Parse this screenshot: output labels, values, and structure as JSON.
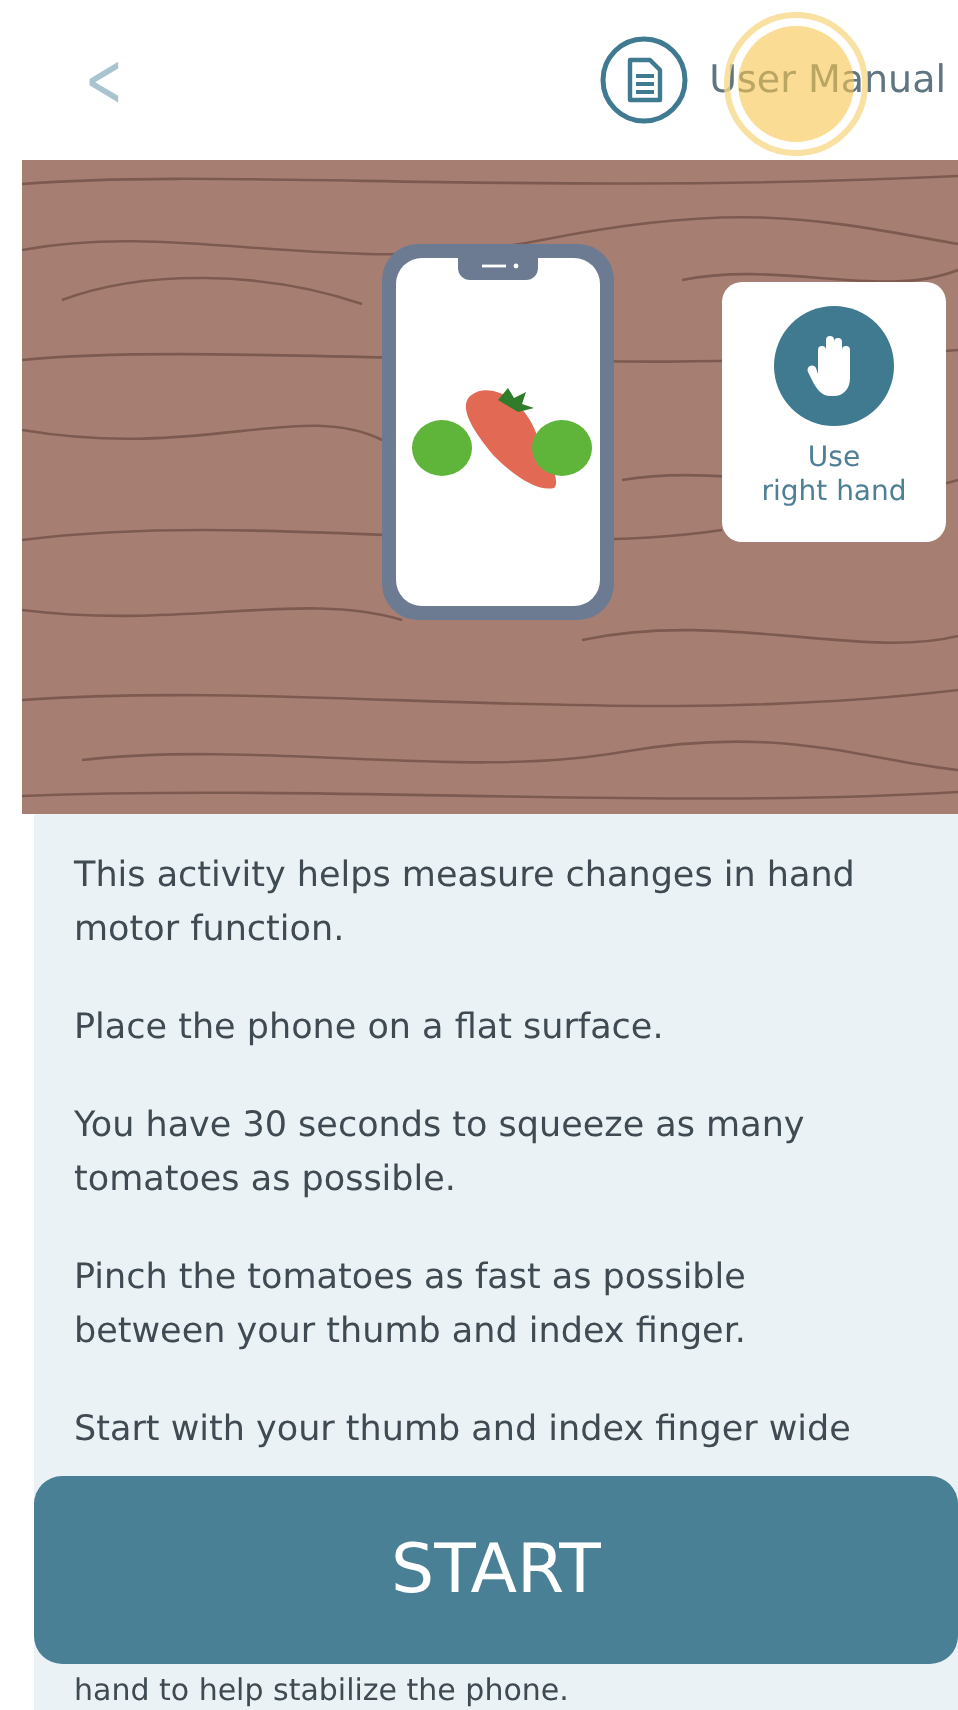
{
  "header": {
    "back": "<",
    "manual_label": "User Manual",
    "touch_indicator": true
  },
  "hand_card": {
    "label": "Use\nright hand"
  },
  "instructions": [
    "This activity helps measure changes in hand motor function.",
    "Place the phone on a flat surface.",
    "You have 30 seconds to squeeze as many tomatoes as possible.",
    "Pinch the tomatoes as fast as possible between your thumb and index finger.",
    "Start with your thumb and index finger wide"
  ],
  "trailing_text": "hand to help stabilize the phone.",
  "start_button": "START"
}
